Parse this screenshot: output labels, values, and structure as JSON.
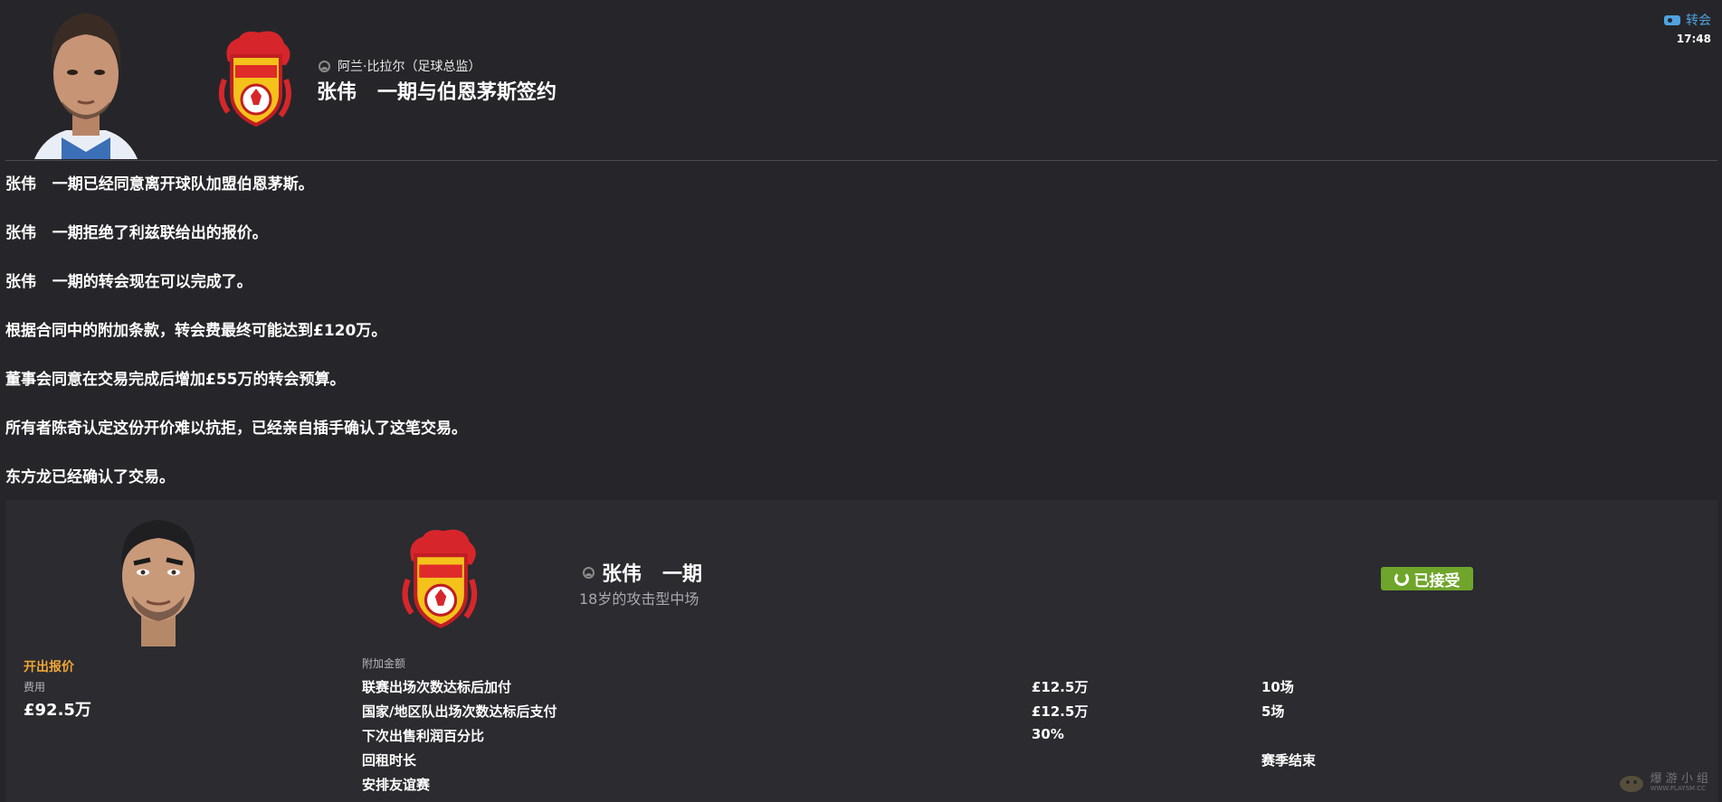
{
  "header": {
    "sender": "阿兰·比拉尔（足球总监）",
    "title": "张伟   一期与伯恩茅斯签约",
    "category": "转会",
    "time": "17:48"
  },
  "message": {
    "lines": [
      "张伟   一期已经同意离开球队加盟伯恩茅斯。",
      "张伟   一期拒绝了利兹联给出的报价。",
      "张伟   一期的转会现在可以完成了。",
      "根据合同中的附加条款，转会费最终可能达到£120万。",
      "董事会同意在交易完成后增加£55万的转会预算。",
      "所有者陈奇认定这份开价难以抗拒，已经亲自插手确认了这笔交易。",
      "东方龙已经确认了交易。"
    ]
  },
  "card": {
    "player_name": "张伟   一期",
    "player_desc": "18岁的攻击型中场",
    "status": "已接受",
    "offer_heading": "开出报价",
    "fee_label": "费用",
    "fee_value": "£92.5万",
    "addons_label": "附加金额",
    "addons": [
      {
        "name": "联赛出场次数达标后加付",
        "amount": "£12.5万",
        "condition": "10场"
      },
      {
        "name": "国家/地区队出场次数达标后支付",
        "amount": "£12.5万",
        "condition": "5场"
      },
      {
        "name": "下次出售利润百分比",
        "amount": "30%",
        "condition": ""
      },
      {
        "name": "回租时长",
        "amount": "",
        "condition": "赛季结束"
      },
      {
        "name": "安排友谊赛",
        "amount": "",
        "condition": ""
      }
    ]
  },
  "watermark": {
    "text": "爆 游 小 组",
    "sub": "WWW.PLAYSM.CC"
  },
  "colors": {
    "background": "#26262a",
    "card": "#2b2b30",
    "accent_orange": "#f0a535",
    "accepted_green": "#6fa52a",
    "link_blue": "#4fa3e0"
  },
  "icons": [
    "person-icon",
    "transfer-tag-icon",
    "refresh-icon",
    "club-badge",
    "player-avatar"
  ]
}
